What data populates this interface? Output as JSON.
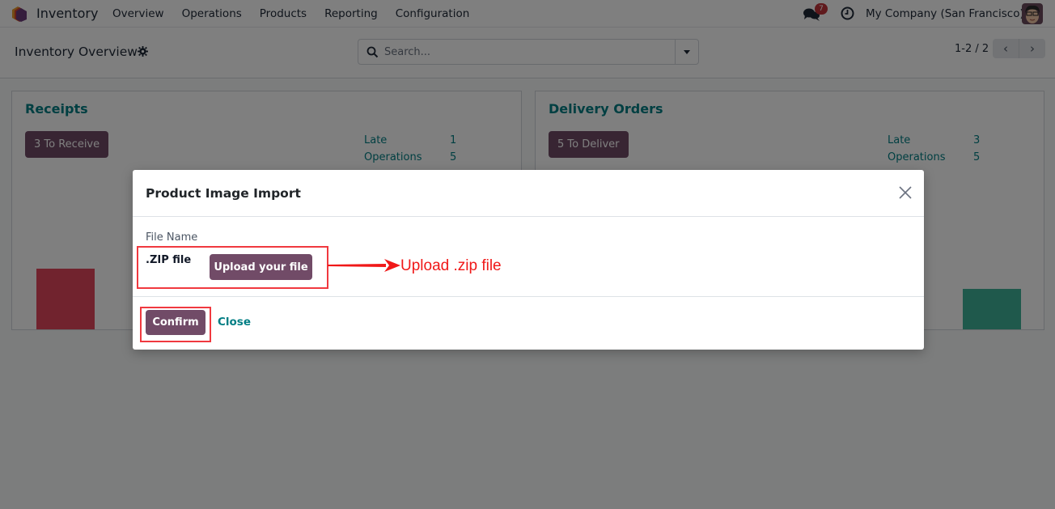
{
  "navbar": {
    "app_name": "Inventory",
    "menu": [
      "Overview",
      "Operations",
      "Products",
      "Reporting",
      "Configuration"
    ],
    "chat_badge_count": "7",
    "company": "My Company (San Francisco)",
    "icons": {
      "logo": "app-logo-icon",
      "chat": "chat-bubbles-icon",
      "activity": "clock-icon",
      "avatar": "user-avatar"
    }
  },
  "control_panel": {
    "title": "Inventory Overview",
    "search_placeholder": "Search...",
    "pager": "1-2 / 2",
    "pager_prev": "‹",
    "pager_next": "›"
  },
  "cards": [
    {
      "title": "Receipts",
      "button_label": "3 To Receive",
      "stats": [
        {
          "label": "Late",
          "value": "1"
        },
        {
          "label": "Operations",
          "value": "5"
        }
      ],
      "bar_color": "#e3475d"
    },
    {
      "title": "Delivery Orders",
      "button_label": "5 To Deliver",
      "stats": [
        {
          "label": "Late",
          "value": "3"
        },
        {
          "label": "Operations",
          "value": "5"
        }
      ],
      "bar_color": "#3fb399"
    }
  ],
  "modal": {
    "title": "Product Image Import",
    "field_label": "File Name",
    "field_value": ".ZIP file",
    "upload_button": "Upload your file",
    "confirm_button": "Confirm",
    "close_link": "Close"
  },
  "annotation": {
    "text": "Upload .zip file",
    "color": "#f0393f"
  },
  "colors": {
    "primary": "#714b67",
    "link": "#017e84",
    "badge": "#c1353a"
  }
}
